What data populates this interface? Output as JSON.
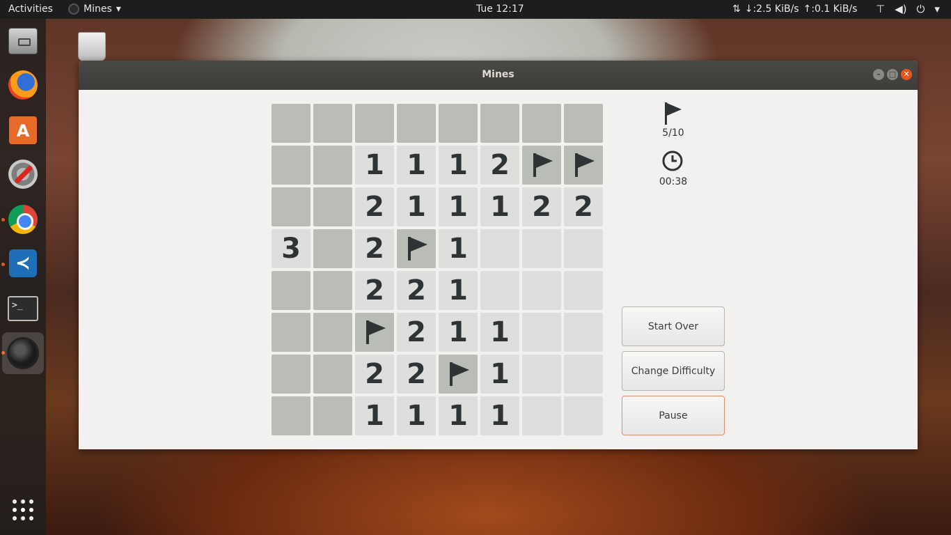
{
  "topbar": {
    "activities": "Activities",
    "app_name": "Mines",
    "clock": "Tue 12:17",
    "net_down": "↓:2.5 KiB/s",
    "net_up": "↑:0.1 KiB/s"
  },
  "dock": {
    "items": [
      "files-icon",
      "firefox-icon",
      "software-store-icon",
      "settings-icon",
      "chrome-icon",
      "vscode-icon",
      "terminal-icon",
      "mines-icon"
    ],
    "show_apps": "grid-icon"
  },
  "window": {
    "title": "Mines"
  },
  "game": {
    "flags_label": "5/10",
    "time_label": "00:38",
    "board": [
      [
        "C",
        "C",
        "C",
        "C",
        "C",
        "C",
        "C",
        "C"
      ],
      [
        "C",
        "C",
        "1",
        "1",
        "1",
        "2",
        "F",
        "F"
      ],
      [
        "C",
        "C",
        "2",
        "1",
        "1",
        "1",
        "2",
        "2"
      ],
      [
        "3",
        "C",
        "2",
        "F",
        "1",
        "",
        "",
        ""
      ],
      [
        "C",
        "C",
        "2",
        "2",
        "1",
        "",
        "",
        ""
      ],
      [
        "C",
        "C",
        "F",
        "2",
        "1",
        "1",
        "",
        ""
      ],
      [
        "C",
        "C",
        "2",
        "2",
        "F",
        "1",
        "",
        ""
      ],
      [
        "C",
        "C",
        "1",
        "1",
        "1",
        "1",
        "",
        ""
      ]
    ]
  },
  "buttons": {
    "start_over": "Start Over",
    "change_difficulty": "Change Difficulty",
    "pause": "Pause"
  },
  "colors": {
    "accent": "#e9541e",
    "covered": "#babdb6",
    "open": "#dededc",
    "text": "#2e3436"
  }
}
